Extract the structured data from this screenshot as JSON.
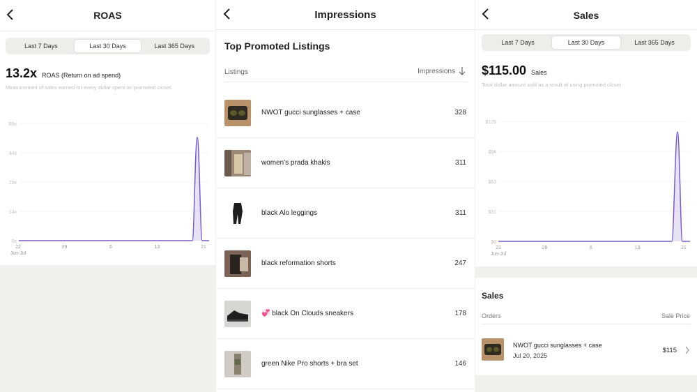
{
  "roas": {
    "title": "ROAS",
    "tabs": [
      "Last 7 Days",
      "Last 30 Days",
      "Last 365 Days"
    ],
    "active_tab": 1,
    "value": "13.2x",
    "value_label": "ROAS (Return on ad spend)",
    "description": "Measurement of sales earned for every dollar spent on promoted closet.",
    "chart_data": {
      "type": "area",
      "y_ticks": [
        "0x",
        "14x",
        "29x",
        "44x",
        "59x"
      ],
      "x_ticks": [
        "22",
        "29",
        "6",
        "13",
        "21"
      ],
      "x_sublabel": "Jun-Jul",
      "ylim": [
        0,
        59
      ],
      "peak_value": 52,
      "color": "#7b5cc4"
    }
  },
  "impressions": {
    "title": "Impressions",
    "section_title": "Top Promoted Listings",
    "col_listings": "Listings",
    "col_impressions": "Impressions",
    "sort_icon": "arrow-down-icon",
    "rows": [
      {
        "name": "NWOT gucci sunglasses + case",
        "value": "328"
      },
      {
        "name": "women's prada khakis",
        "value": "311"
      },
      {
        "name": "black Alo leggings",
        "value": "311"
      },
      {
        "name": "black reformation shorts",
        "value": "247"
      },
      {
        "name": "💞 black On Clouds sneakers",
        "value": "178"
      },
      {
        "name": "green Nike Pro shorts + bra set",
        "value": "146"
      }
    ]
  },
  "sales": {
    "title": "Sales",
    "tabs": [
      "Last 7 Days",
      "Last 30 Days",
      "Last 365 Days"
    ],
    "active_tab": 1,
    "value": "$115.00",
    "value_label": "Sales",
    "description": "Total dollar amount sold as a result of using promoted closet.",
    "chart_data": {
      "type": "area",
      "y_ticks": [
        "$0",
        "$31",
        "$63",
        "$94",
        "$126"
      ],
      "x_ticks": [
        "22",
        "29",
        "6",
        "13",
        "21"
      ],
      "x_sublabel": "Jun-Jul",
      "ylim": [
        0,
        126
      ],
      "peak_value": 115,
      "color": "#7b5cc4"
    },
    "section_title": "Sales",
    "col_orders": "Orders",
    "col_price": "Sale Price",
    "orders": [
      {
        "name": "NWOT gucci sunglasses + case",
        "date": "Jul 20, 2025",
        "price": "$115"
      }
    ]
  }
}
